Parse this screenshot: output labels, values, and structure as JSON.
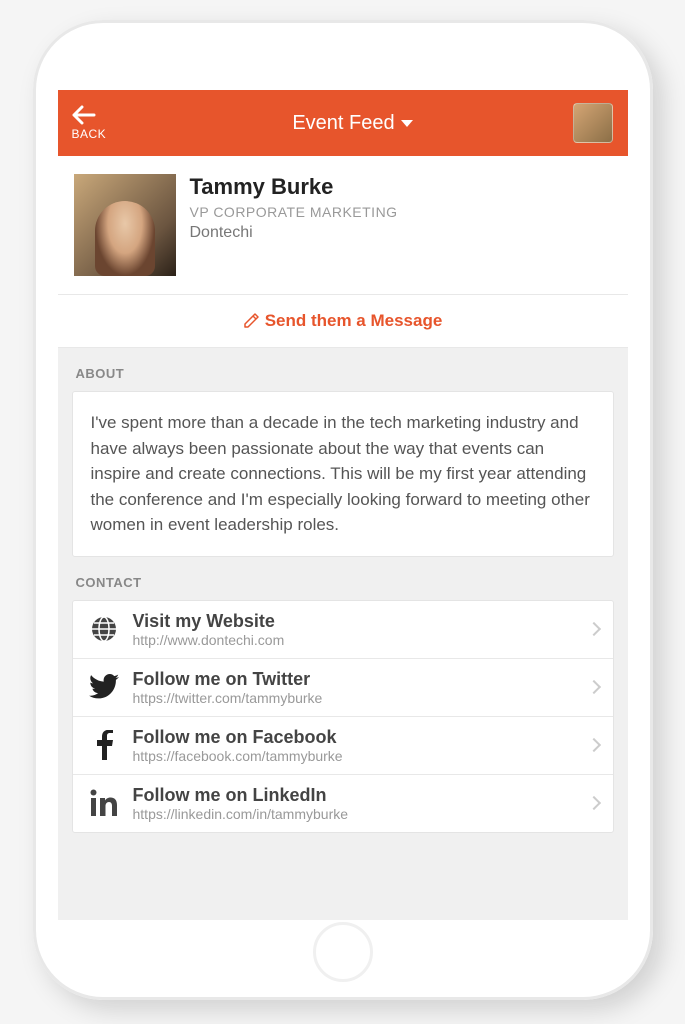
{
  "header": {
    "back_label": "BACK",
    "title": "Event Feed"
  },
  "profile": {
    "name": "Tammy Burke",
    "role": "VP CORPORATE MARKETING",
    "company": "Dontechi"
  },
  "actions": {
    "send_message": "Send them a Message"
  },
  "sections": {
    "about_label": "ABOUT",
    "contact_label": "CONTACT"
  },
  "about": {
    "text": "I've spent more than a decade in the tech marketing industry and have always been passionate about the way that events can inspire and create connections. This will be my first year attending the conference and I'm especially looking forward to meeting other women in event leadership roles."
  },
  "contacts": [
    {
      "icon": "globe",
      "title": "Visit my Website",
      "sub": "http://www.dontechi.com"
    },
    {
      "icon": "twitter",
      "title": "Follow me on Twitter",
      "sub": "https://twitter.com/tammyburke"
    },
    {
      "icon": "facebook",
      "title": "Follow me on Facebook",
      "sub": "https://facebook.com/tammyburke"
    },
    {
      "icon": "linkedin",
      "title": "Follow me on LinkedIn",
      "sub": "https://linkedin.com/in/tammyburke"
    }
  ]
}
